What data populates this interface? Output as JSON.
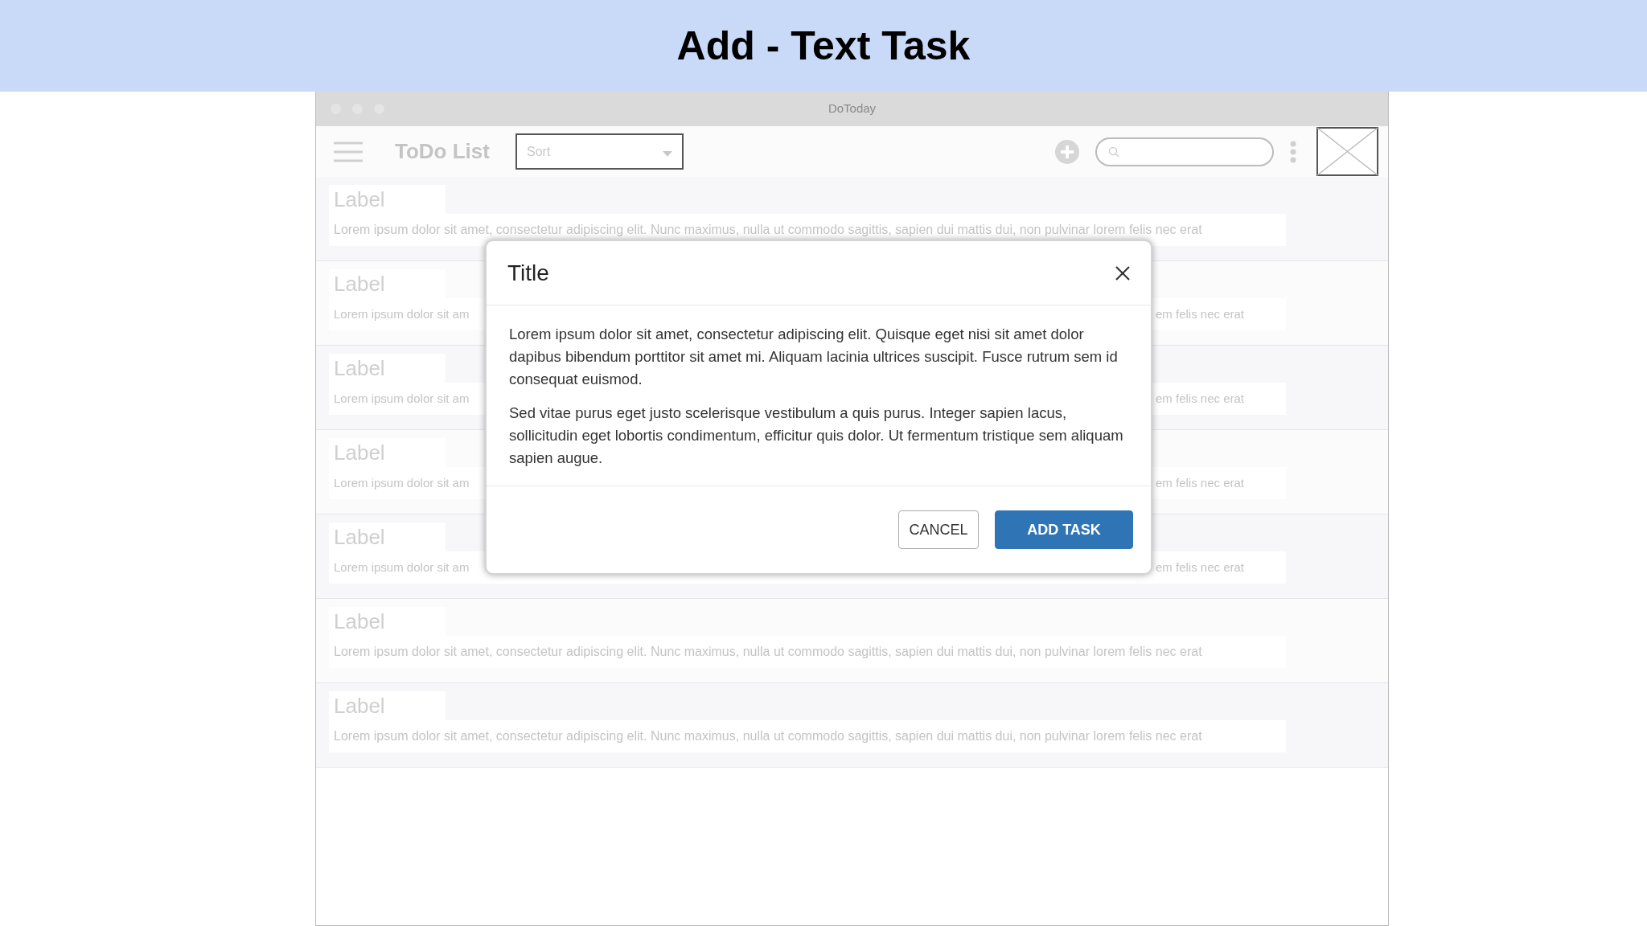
{
  "page_title": "Add - Text Task",
  "window": {
    "title": "DoToday"
  },
  "toolbar": {
    "title": "ToDo List",
    "sort": {
      "placeholder": "Sort"
    }
  },
  "rows": [
    {
      "kind": "full",
      "label": "Label",
      "text": "Lorem ipsum dolor sit amet, consectetur adipiscing elit. Nunc maximus, nulla ut commodo sagittis, sapien dui mattis dui, non pulvinar lorem felis nec erat"
    },
    {
      "kind": "covered",
      "label": "Label",
      "text_start": "Lorem ipsum dolor sit am",
      "text_end": "em felis nec erat"
    },
    {
      "kind": "covered",
      "label": "Label",
      "text_start": "Lorem ipsum dolor sit am",
      "text_end": "em felis nec erat"
    },
    {
      "kind": "covered",
      "label": "Label",
      "text_start": "Lorem ipsum dolor sit am",
      "text_end": "em felis nec erat"
    },
    {
      "kind": "covered",
      "label": "Label",
      "text_start": "Lorem ipsum dolor sit am",
      "text_end": "em felis nec erat"
    },
    {
      "kind": "full",
      "label": "Label",
      "text": "Lorem ipsum dolor sit amet, consectetur adipiscing elit. Nunc maximus, nulla ut commodo sagittis, sapien dui mattis dui, non pulvinar lorem felis nec erat"
    },
    {
      "kind": "full",
      "label": "Label",
      "text": "Lorem ipsum dolor sit amet, consectetur adipiscing elit. Nunc maximus, nulla ut commodo sagittis, sapien dui mattis dui, non pulvinar lorem felis nec erat"
    }
  ],
  "dialog": {
    "title": "Title",
    "paragraphs": [
      "Lorem ipsum dolor sit amet, consectetur adipiscing elit. Quisque eget nisi sit amet dolor dapibus bibendum porttitor sit amet mi. Aliquam lacinia ultrices suscipit. Fusce rutrum sem id consequat euismod.",
      "Sed vitae purus eget justo scelerisque vestibulum a quis purus. Integer sapien lacus, sollicitudin eget lobortis condimentum, efficitur quis dolor. Ut fermentum tristique sem aliquam sapien augue."
    ],
    "buttons": [
      {
        "kind": "secondary",
        "label": "CANCEL"
      },
      {
        "kind": "primary",
        "label": "ADD TASK"
      }
    ]
  }
}
